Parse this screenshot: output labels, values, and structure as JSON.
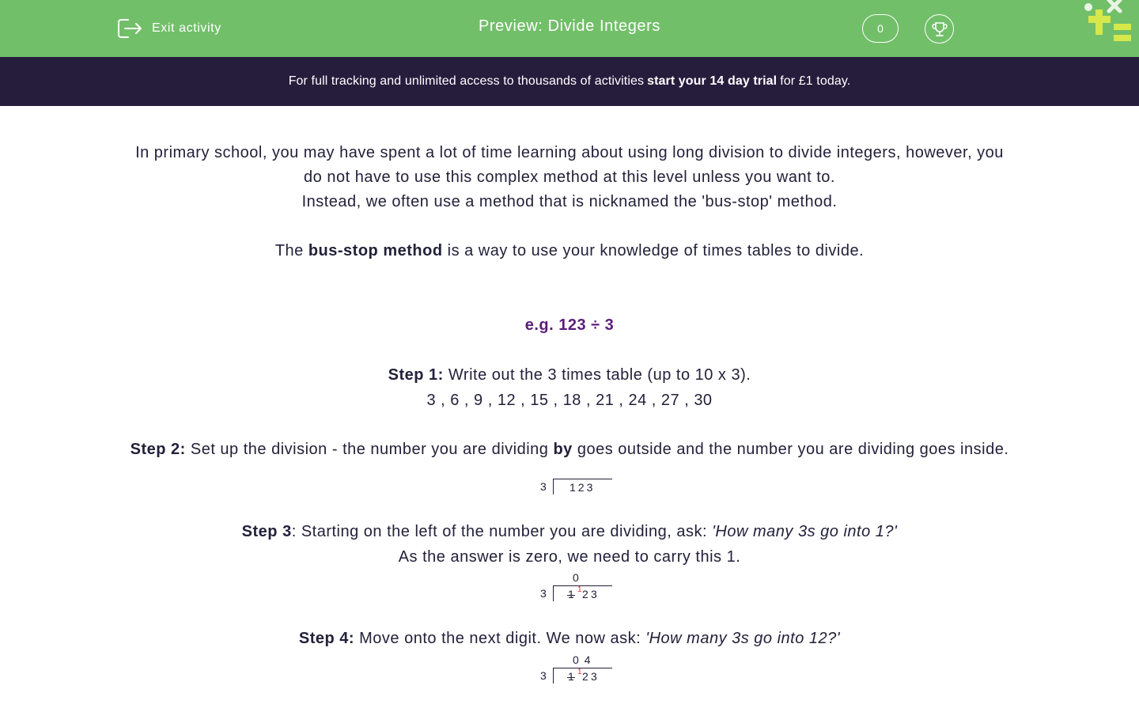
{
  "header": {
    "exit_label": "Exit activity",
    "title": "Preview: Divide Integers",
    "score": "0",
    "bg_color": "#72bf6a"
  },
  "banner": {
    "text_before": "For full tracking and unlimited access to thousands of activities",
    "cta": "start your 14 day trial",
    "text_after": "for £1 today.",
    "bg_color": "#261d3d"
  },
  "intro": {
    "line1": "In primary school, you may have spent a lot of time learning about using long division to divide integers, however, you",
    "line2": "do not have to use this complex method at this level unless you want to.",
    "line3": "Instead, we often use a method that is nicknamed the 'bus-stop' method.",
    "def_before": "The",
    "def_bold": "bus-stop method",
    "def_after": "is a way to use your knowledge of times tables to divide."
  },
  "example": {
    "label": "e.g. 123 ÷ 3",
    "color": "#5d1d7a"
  },
  "steps": [
    {
      "title": "Step 1:",
      "text": "Write out the 3 times table (up to 10 x 3).",
      "extra": "3 , 6 , 9 , 12 , 15 , 18 , 21 , 24 , 27 , 30"
    },
    {
      "title": "Step 2:",
      "text_before": "Set up the division - the number you are dividing",
      "text_bold": "by",
      "text_after": "goes outside and the number you are dividing goes inside."
    },
    {
      "title": "Step 3",
      "text": ": Starting on the left of the number you are dividing, ask:",
      "italic": "'How many 3s go into 1?'",
      "extra": "As the answer is zero, we need to carry this 1."
    },
    {
      "title": "Step 4:",
      "text": "Move onto the next digit. We now ask:",
      "italic": "'How many 3s go into 12?'"
    }
  ],
  "diagrams": {
    "divisor": "3",
    "dividend": "123",
    "d1": "1",
    "d2": "2",
    "d3": "3",
    "carry": "1",
    "quotient_step3": "0",
    "quotient_step4": "04"
  }
}
